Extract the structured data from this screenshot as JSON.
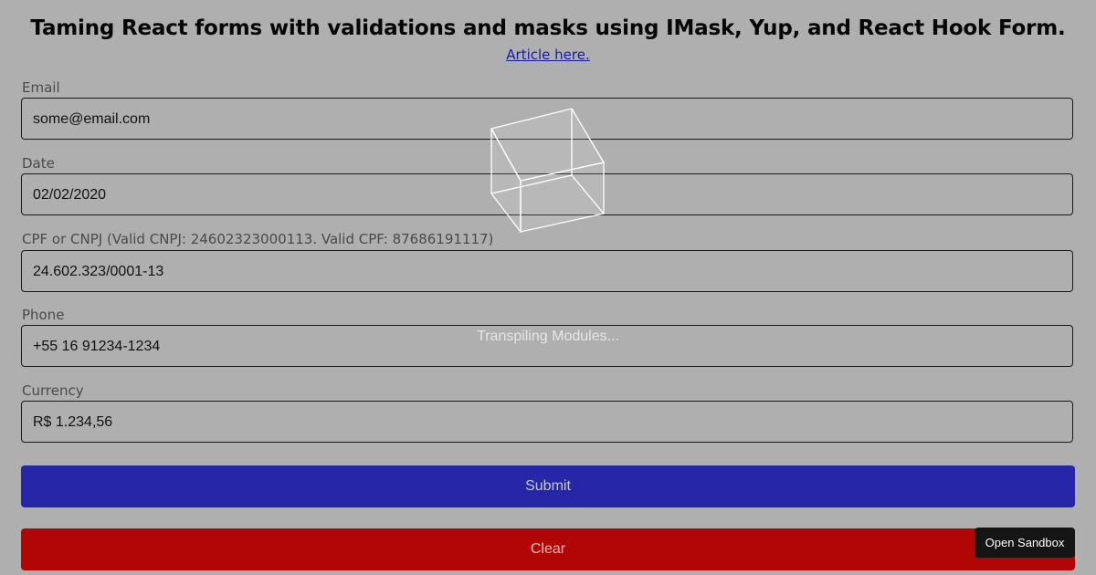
{
  "header": {
    "title": "Taming React forms with validations and masks using IMask, Yup, and React Hook Form.",
    "article_link": "Article here."
  },
  "form": {
    "fields": [
      {
        "label": "Email",
        "value": "some@email.com"
      },
      {
        "label": "Date",
        "value": "02/02/2020"
      },
      {
        "label": "CPF or CNPJ (Valid CNPJ: 24602323000113. Valid CPF: 87686191117)",
        "value": "24.602.323/0001-13"
      },
      {
        "label": "Phone",
        "value": "+55 16 91234-1234"
      },
      {
        "label": "Currency",
        "value": "R$ 1.234,56"
      }
    ],
    "submit_label": "Submit",
    "clear_label": "Clear"
  },
  "overlay": {
    "status_text": "Transpiling Modules...",
    "icon": "cube-icon"
  },
  "sandbox": {
    "open_label": "Open Sandbox"
  },
  "colors": {
    "background": "#afafaf",
    "submit": "#2626a8",
    "clear": "#b00606",
    "sandbox_button": "#151515"
  }
}
